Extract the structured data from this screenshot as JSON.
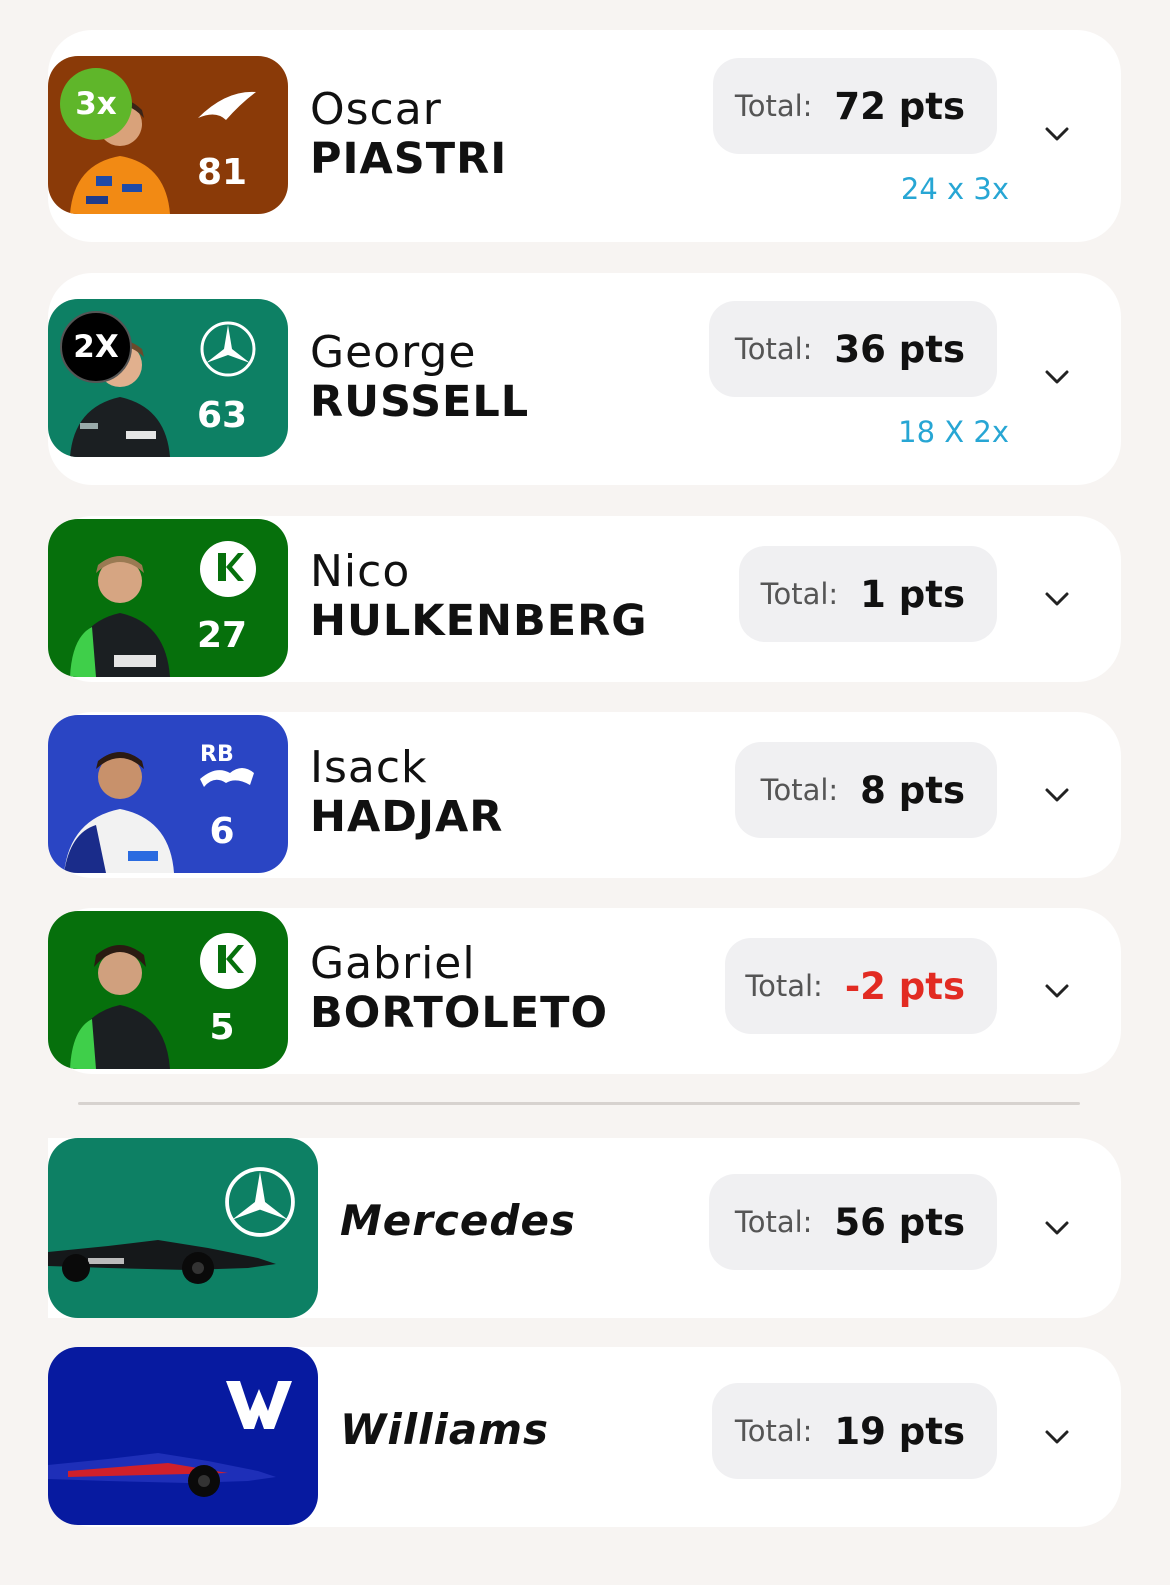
{
  "drivers": [
    {
      "first": "Oscar",
      "last": "PIASTRI",
      "number": "81",
      "multiplier": "3x",
      "total_label": "Total:",
      "total": "72 pts",
      "note": "24 x 3x",
      "team_color": "#8a3a08"
    },
    {
      "first": "George",
      "last": "RUSSELL",
      "number": "63",
      "multiplier": "2X",
      "total_label": "Total:",
      "total": "36 pts",
      "note": "18 X 2x",
      "team_color": "#0d8064"
    },
    {
      "first": "Nico",
      "last": "HULKENBERG",
      "number": "27",
      "total_label": "Total:",
      "total": "1 pts",
      "team_color": "#06700c"
    },
    {
      "first": "Isack",
      "last": "HADJAR",
      "number": "6",
      "total_label": "Total:",
      "total": "8 pts",
      "team_color": "#2a45c4"
    },
    {
      "first": "Gabriel",
      "last": "BORTOLETO",
      "number": "5",
      "total_label": "Total:",
      "total": "-2 pts",
      "team_color": "#06700c"
    }
  ],
  "teams": [
    {
      "name": "Mercedes",
      "total_label": "Total:",
      "total": "56 pts",
      "team_color": "#0d8064"
    },
    {
      "name": "Williams",
      "total_label": "Total:",
      "total": "19 pts",
      "team_color": "#071aa0"
    }
  ],
  "colors": {
    "accent_note": "#27a6d4",
    "negative": "#e22b22",
    "multiplier_3x": "#5fb62a",
    "multiplier_2x": "#000000"
  },
  "icons": {
    "expand": "chevron-down-icon"
  }
}
